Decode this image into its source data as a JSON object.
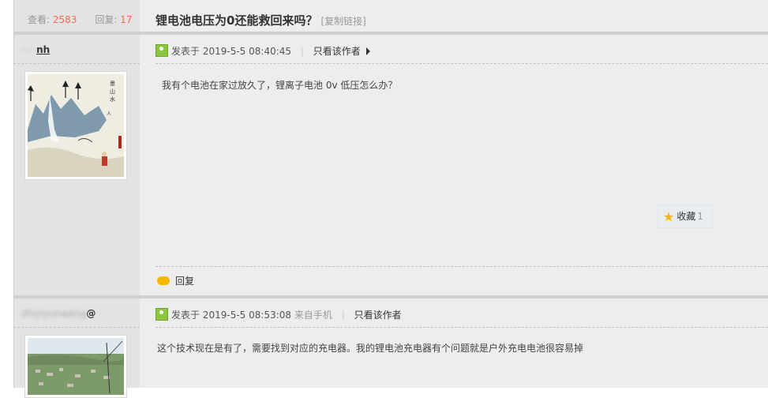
{
  "stats": {
    "views_label": "查看:",
    "views": "2583",
    "replies_label": "回复:",
    "replies": "17"
  },
  "thread": {
    "title": "锂电池电压为0还能救回来吗？",
    "copy_link": "[复制链接]"
  },
  "posts": [
    {
      "author_masked": "·····",
      "author_visible": "nh",
      "posted_label": "发表于",
      "timestamp": "2019-5-5 08:40:45",
      "view_author_only": "只看该作者",
      "content": "我有个电池在家过放久了，锂离子电池 0v 低压怎么办？",
      "favorite_label": "收藏",
      "favorite_count": "1",
      "reply_label": "回复"
    },
    {
      "author_masked": "zhiyiyunweng",
      "author_visible": "@",
      "posted_label": "发表于",
      "timestamp": "2019-5-5 08:53:08",
      "device": "来自手机",
      "view_author_only": "只看该作者",
      "content": "这个技术现在是有了，需要找到对应的充电器。我的锂电池充电器有个问题就是户外充电电池很容易掉"
    }
  ],
  "icons": {
    "user": "user-icon",
    "arrow": "triangle-right-icon",
    "favorite": "star-icon",
    "reply": "speech-bubble-icon"
  },
  "colors": {
    "count_accent": "#f26c4f",
    "post_icon": "#8cc63f",
    "star": "#f7b500",
    "reply_icon": "#f5b800"
  }
}
